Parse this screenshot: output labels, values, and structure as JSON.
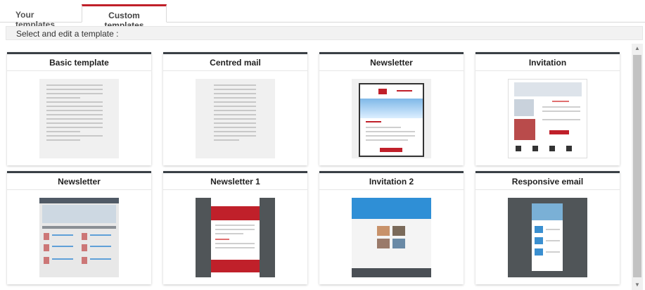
{
  "tabs": {
    "your_templates": "Your templates",
    "custom_templates": "Custom templates",
    "active": "custom_templates"
  },
  "instruction": "Select and edit a template :",
  "templates": [
    {
      "title": "Basic template"
    },
    {
      "title": "Centred mail"
    },
    {
      "title": "Newsletter"
    },
    {
      "title": "Invitation"
    },
    {
      "title": "Newsletter"
    },
    {
      "title": "Newsletter 1"
    },
    {
      "title": "Invitation 2"
    },
    {
      "title": "Responsive email"
    }
  ],
  "colors": {
    "accent": "#c0202a",
    "card_top_border": "#3a4046"
  }
}
